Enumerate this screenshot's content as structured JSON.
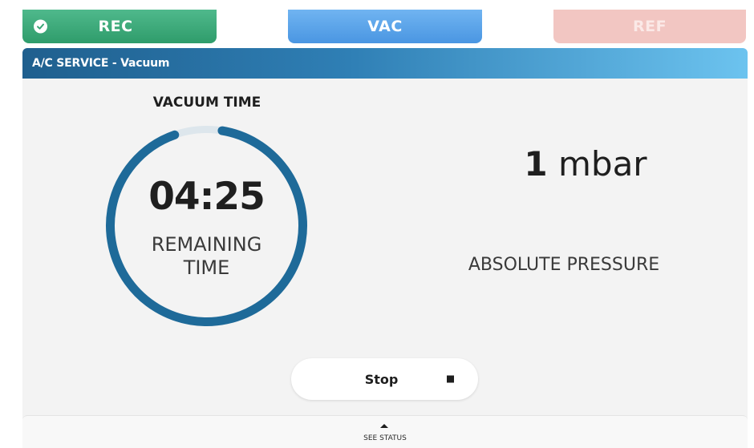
{
  "tabs": [
    {
      "label": "REC",
      "state": "completed",
      "icon": "check-icon",
      "color": "#3aa676"
    },
    {
      "label": "VAC",
      "state": "active",
      "color": "#5aa5eb"
    },
    {
      "label": "REF",
      "state": "pending",
      "color": "#f2c6c2"
    }
  ],
  "header": {
    "title": "A/C SERVICE - Vacuum"
  },
  "vacuum": {
    "title": "VACUUM TIME",
    "remaining_time": "04:25",
    "remaining_label_line1": "REMAINING",
    "remaining_label_line2": "TIME",
    "progress_fraction": 0.92,
    "ring_color": "#1e6a99",
    "ring_track_color": "#dde6ec"
  },
  "pressure": {
    "value": "1",
    "unit": "mbar",
    "label": "ABSOLUTE PRESSURE"
  },
  "stop_button": {
    "label": "Stop",
    "icon": "stop-icon"
  },
  "status_drawer": {
    "label": "SEE STATUS",
    "icon": "caret-up-icon"
  }
}
